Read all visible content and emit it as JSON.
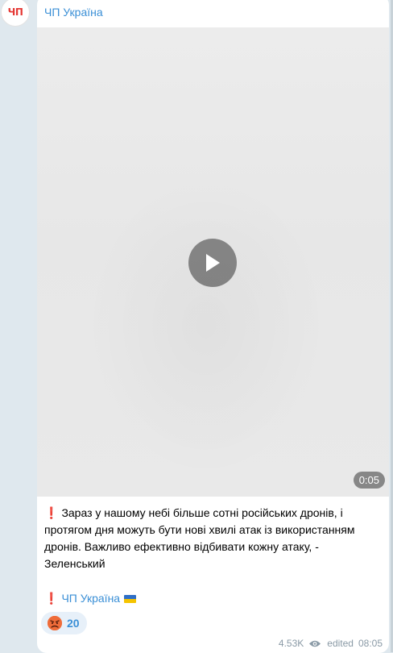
{
  "channel": {
    "avatar_text": "ЧП",
    "name": "ЧП Україна"
  },
  "video": {
    "duration": "0:05"
  },
  "message": {
    "caption": "Зараз у нашому небі більше сотні російських дронів, і протягом дня можуть бути нові хвилі атак із використанням дронів. Важливо ефективно відбивати кожну атаку, - Зеленський",
    "signature": "ЧП Україна"
  },
  "reaction": {
    "count": "20"
  },
  "footer": {
    "views": "4.53K",
    "edited": "edited",
    "time": "08:05"
  },
  "colors": {
    "accent": "#3a8fd6",
    "alert_red": "#e53935",
    "background": "#dfe8ee"
  }
}
